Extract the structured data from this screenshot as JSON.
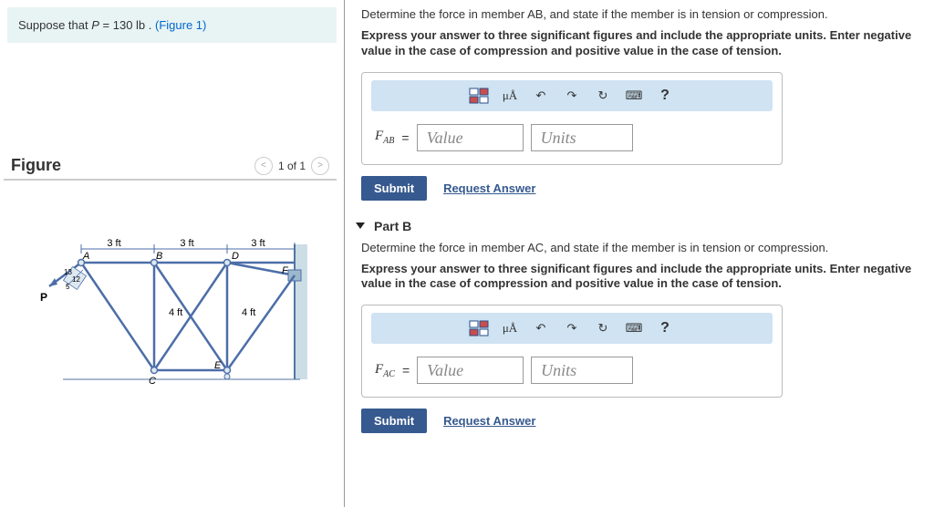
{
  "problem": {
    "prefix": "Suppose that ",
    "variable": "P",
    "value_text": " = 130 lb . ",
    "figure_link": "(Figure 1)"
  },
  "figure": {
    "title": "Figure",
    "counter": "1 of 1"
  },
  "truss": {
    "seg1": "3 ft",
    "seg2": "3 ft",
    "seg3": "3 ft",
    "h1": "4 ft",
    "h2": "4 ft",
    "angle_upper": "13",
    "angle_lower": "12",
    "angle_hyp": "5",
    "nodes": {
      "A": "A",
      "B": "B",
      "C": "C",
      "D": "D",
      "E": "E",
      "F": "F",
      "P": "P"
    }
  },
  "partA": {
    "question": "Determine the force in member AB, and state if the member is in tension or compression.",
    "instruction": "Express your answer to three significant figures and include the appropriate units. Enter negative value in the case of compression and positive value in the case of tension.",
    "var_main": "F",
    "var_sub": "AB",
    "value_placeholder": "Value",
    "units_placeholder": "Units",
    "submit": "Submit",
    "request": "Request Answer"
  },
  "partB": {
    "header": "Part B",
    "question": "Determine the force in member AC, and state if the member is in tension or compression.",
    "instruction": "Express your answer to three significant figures and include the appropriate units. Enter negative value in the case of compression and positive value in the case of tension.",
    "var_main": "F",
    "var_sub": "AC",
    "value_placeholder": "Value",
    "units_placeholder": "Units",
    "submit": "Submit",
    "request": "Request Answer"
  },
  "toolbar": {
    "templates": "templates-icon",
    "units_symbol": "μÅ",
    "undo": "↶",
    "redo": "↷",
    "reset": "↻",
    "keyboard": "⌨",
    "help": "?"
  }
}
